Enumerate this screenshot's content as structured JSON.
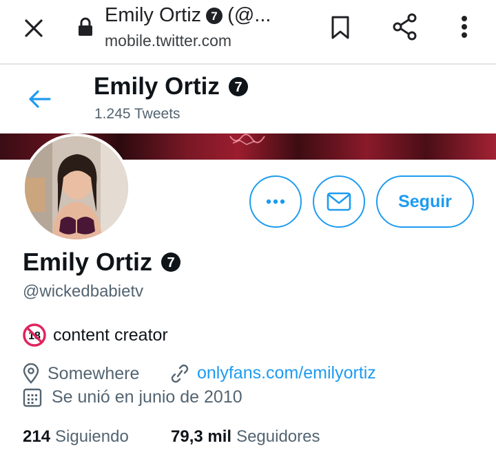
{
  "browser": {
    "page_title": "Emily Ortiz",
    "page_title_suffix": "(@...",
    "url": "mobile.twitter.com"
  },
  "header": {
    "name": "Emily Ortiz",
    "tweet_count": "1.245 Tweets"
  },
  "profile": {
    "display_name": "Emily Ortiz",
    "handle": "@wickedbabietv",
    "bio": "content creator",
    "location": "Somewhere",
    "website": "onlyfans.com/emilyortiz",
    "joined": "Se unió en junio de 2010",
    "following_count": "214",
    "following_label": "Siguiendo",
    "followers_count": "79,3 mil",
    "followers_label": "Seguidores"
  },
  "actions": {
    "follow_label": "Seguir"
  },
  "badges": {
    "verified_glyph": "7",
    "adult_glyph": "18"
  },
  "colors": {
    "accent": "#1d9bf0",
    "text_primary": "#0f1419",
    "text_secondary": "#536471"
  }
}
